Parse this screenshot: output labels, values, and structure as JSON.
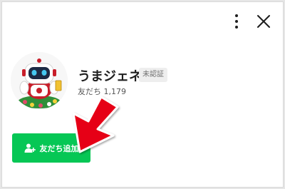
{
  "window": {
    "more_icon": "more-vertical-icon",
    "close_icon": "close-icon"
  },
  "profile": {
    "name": "うまジェネ",
    "verification_badge": "未認証",
    "friends_label": "友だち 1,179"
  },
  "actions": {
    "add_friend_label": "友だち追加",
    "add_friend_icon": "person-add-icon"
  },
  "colors": {
    "accent_green": "#06c755",
    "annotation_arrow": "#e60012",
    "text_primary": "#1e1e1e",
    "text_secondary": "#555555"
  }
}
